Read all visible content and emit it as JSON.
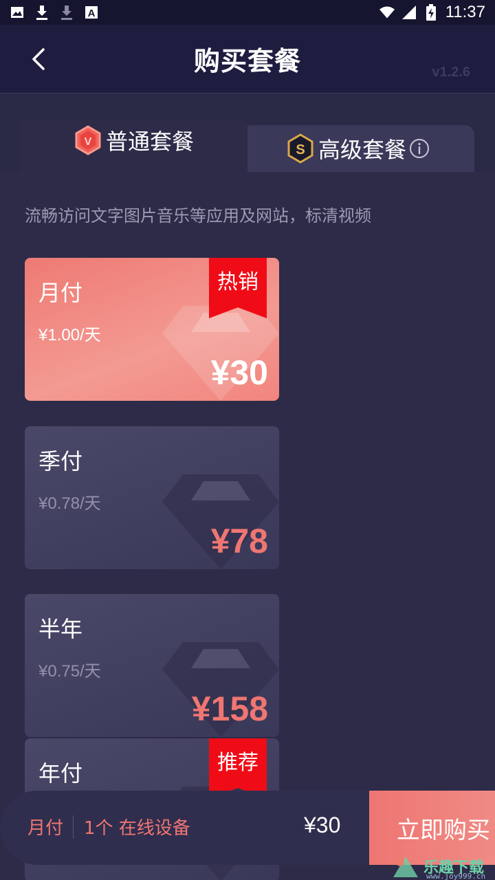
{
  "status_bar": {
    "time": "11:37",
    "left_icons": [
      "image-icon",
      "download-icon",
      "download-icon",
      "text-icon"
    ],
    "right_icons": [
      "wifi-icon",
      "signal-icon",
      "battery-charging-icon"
    ]
  },
  "header": {
    "title": "购买套餐",
    "version": "v1.2.6"
  },
  "tabs": [
    {
      "label": "普通套餐",
      "badge": "V",
      "active": true
    },
    {
      "label": "高级套餐",
      "badge": "S",
      "active": false
    }
  ],
  "description": "流畅访问文字图片音乐等应用及网站，标清视频",
  "plans": [
    {
      "name": "月付",
      "daily": "¥1.00/天",
      "price": "¥30",
      "tag": "热销",
      "selected": true
    },
    {
      "name": "季付",
      "daily": "¥0.78/天",
      "price": "¥78",
      "tag": "",
      "selected": false
    },
    {
      "name": "半年",
      "daily": "¥0.75/天",
      "price": "¥158",
      "tag": "",
      "selected": false
    },
    {
      "name": "年付",
      "daily": "",
      "price": "",
      "tag": "推荐",
      "selected": false
    }
  ],
  "bottom_bar": {
    "plan": "月付",
    "devices": "1个 在线设备",
    "price": "¥30",
    "buy_label": "立即购买"
  },
  "watermark": {
    "text": "乐趣下载",
    "url": "www.joy999.cn"
  },
  "colors": {
    "accent": "#ef7672",
    "ribbon": "#ef0c17",
    "background": "#2d2b48",
    "header": "#1e1d3f"
  }
}
